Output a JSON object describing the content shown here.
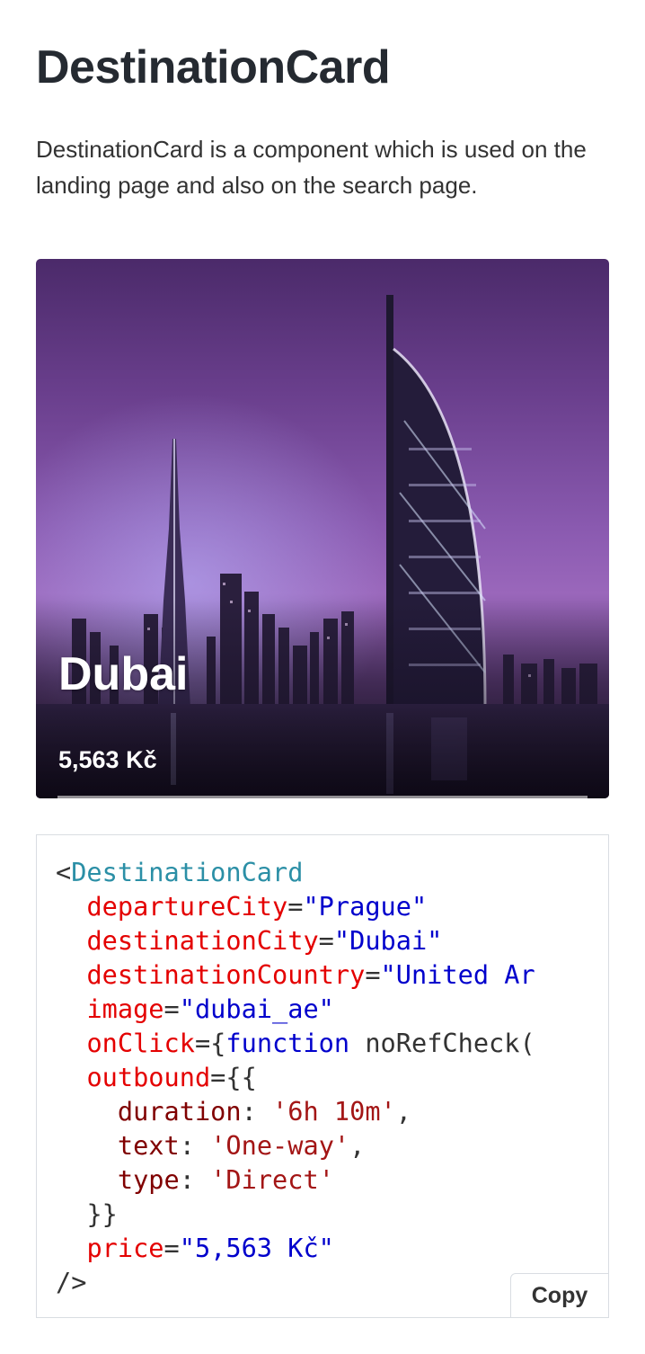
{
  "page": {
    "title": "DestinationCard",
    "description": "DestinationCard is a component which is used on the landing page and also on the search page."
  },
  "card": {
    "city": "Dubai",
    "price": "5,563 Kč",
    "image_subject": "Dubai skyline at night with Burj Al Arab"
  },
  "code": {
    "open_bracket": "<",
    "component": "DestinationCard",
    "props": [
      {
        "name": "departureCity",
        "value": "\"Prague\""
      },
      {
        "name": "destinationCity",
        "value": "\"Dubai\""
      },
      {
        "name": "destinationCountry",
        "value": "\"United Ar"
      },
      {
        "name": "image",
        "value": "\"dubai_ae\""
      },
      {
        "name": "onClick",
        "value_prefix": "{",
        "keyword": "function",
        "value_suffix": " noRefCheck("
      },
      {
        "name": "outbound",
        "value": "{{"
      }
    ],
    "outbound_fields": [
      {
        "key": "duration",
        "value": "'6h 10m'",
        "trailing": ","
      },
      {
        "key": "text",
        "value": "'One-way'",
        "trailing": ","
      },
      {
        "key": "type",
        "value": "'Direct'",
        "trailing": ""
      }
    ],
    "outbound_close": "}}",
    "price_prop": {
      "name": "price",
      "value": "\"5,563 Kč\""
    },
    "close": "/>"
  },
  "copy_button": {
    "label": "Copy"
  },
  "colors": {
    "tag": "#2b8fa6",
    "attr": "#e40000",
    "string": "#0000cc",
    "object_key": "#800000",
    "object_value": "#a31515"
  }
}
